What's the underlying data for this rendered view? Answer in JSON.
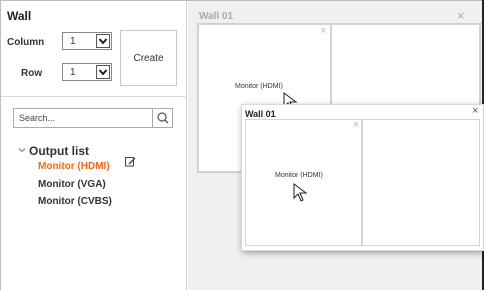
{
  "left_panel": {
    "title": "Wall",
    "column_label": "Column",
    "column_value": "1",
    "row_label": "Row",
    "row_value": "1",
    "create_label": "Create",
    "search_placeholder": "Search...",
    "output_list_title": "Output list",
    "outputs": [
      {
        "label": "Monitor (HDMI)",
        "selected": true
      },
      {
        "label": "Monitor (VGA)",
        "selected": false
      },
      {
        "label": "Monitor (CVBS)",
        "selected": false
      }
    ]
  },
  "wall_back": {
    "title": "Wall 01",
    "close": "×",
    "cell_close": "×",
    "monitor_label": "Monitor (HDMI)"
  },
  "wall_front": {
    "title": "Wall 01",
    "close": "×",
    "cell_close": "×",
    "monitor_label": "Monitor (HDMI)"
  },
  "colors": {
    "accent": "#ee6a1e",
    "panel_bg": "#f0f0f0"
  },
  "icons": [
    "chevron-down-icon",
    "search-icon",
    "edit-icon",
    "close-icon",
    "cursor-icon"
  ]
}
